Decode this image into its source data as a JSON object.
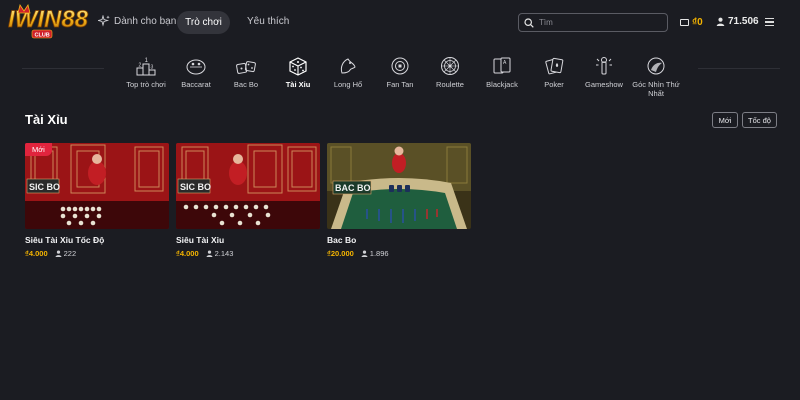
{
  "brand": {
    "logo_text": "IWIN88",
    "logo_sub": "CLUB"
  },
  "nav": {
    "for_you": "Dành cho bạn",
    "games": "Trò chơi",
    "favorites": "Yêu thích"
  },
  "search": {
    "placeholder": "Tìm"
  },
  "account": {
    "wallet_balance": "₫0",
    "user_count": "71.506"
  },
  "categories": [
    {
      "label": "Top trò chơi",
      "icon": "podium-icon"
    },
    {
      "label": "Baccarat",
      "icon": "baccarat-icon"
    },
    {
      "label": "Bac Bo",
      "icon": "dice-pair-icon"
    },
    {
      "label": "Tài Xỉu",
      "icon": "dice-icon",
      "active": true
    },
    {
      "label": "Long Hổ",
      "icon": "dragon-tiger-icon"
    },
    {
      "label": "Fan Tan",
      "icon": "fan-tan-icon"
    },
    {
      "label": "Roulette",
      "icon": "roulette-icon"
    },
    {
      "label": "Blackjack",
      "icon": "blackjack-icon"
    },
    {
      "label": "Poker",
      "icon": "poker-icon"
    },
    {
      "label": "Gameshow",
      "icon": "gameshow-icon"
    },
    {
      "label": "Góc Nhìn Thứ Nhất",
      "icon": "first-person-icon"
    }
  ],
  "section": {
    "title": "Tài Xỉu",
    "filters": {
      "new": "Mới",
      "speed": "Tốc độ"
    }
  },
  "games": [
    {
      "title": "Siêu Tài Xỉu Tốc Độ",
      "bet": "₫4.000",
      "players": "222",
      "badge": "Mới",
      "table_sign": "SIC BO"
    },
    {
      "title": "Siêu Tài Xỉu",
      "bet": "₫4.000",
      "players": "2.143",
      "badge": "",
      "table_sign": "SIC BO"
    },
    {
      "title": "Bac Bo",
      "bet": "₫20.000",
      "players": "1.896",
      "badge": "",
      "table_sign": "BAC BO"
    }
  ],
  "colors": {
    "background": "#1b1c22",
    "accent_gold": "#f5b400",
    "badge_red": "#e0243d",
    "tab_active": "#33343b"
  }
}
